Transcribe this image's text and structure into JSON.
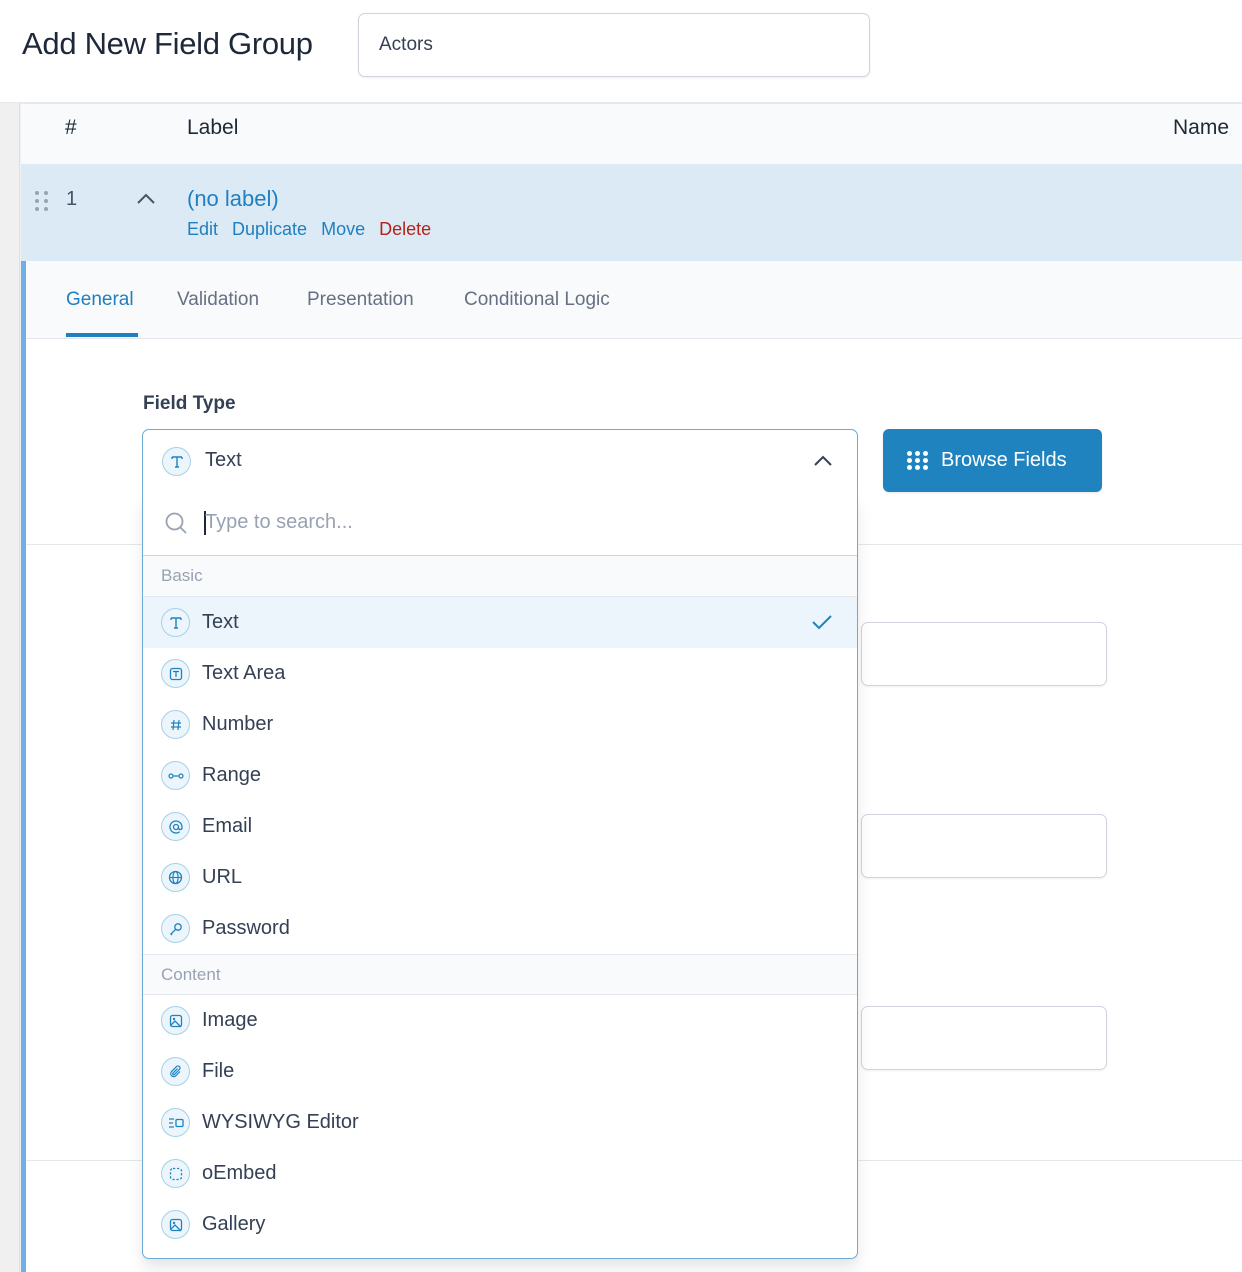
{
  "header": {
    "page_title": "Add New Field Group",
    "title_input_value": "Actors"
  },
  "table": {
    "columns": [
      "#",
      "Label",
      "Name"
    ]
  },
  "field": {
    "number": "1",
    "label": "(no label)",
    "actions": [
      "Edit",
      "Duplicate",
      "Move",
      "Delete"
    ]
  },
  "tabs": [
    {
      "label": "General",
      "active": true
    },
    {
      "label": "Validation",
      "active": false
    },
    {
      "label": "Presentation",
      "active": false
    },
    {
      "label": "Conditional Logic",
      "active": false
    }
  ],
  "field_type": {
    "label": "Field Type",
    "selected": "Text",
    "selected_icon": "text-icon",
    "browse_button": "Browse Fields",
    "search_placeholder": "Type to search...",
    "groups": [
      {
        "name": "Basic",
        "options": [
          {
            "label": "Text",
            "icon": "text-icon",
            "selected": true
          },
          {
            "label": "Text Area",
            "icon": "textarea-icon",
            "selected": false
          },
          {
            "label": "Number",
            "icon": "number-icon",
            "selected": false
          },
          {
            "label": "Range",
            "icon": "range-icon",
            "selected": false
          },
          {
            "label": "Email",
            "icon": "email-icon",
            "selected": false
          },
          {
            "label": "URL",
            "icon": "globe-icon",
            "selected": false
          },
          {
            "label": "Password",
            "icon": "key-icon",
            "selected": false
          }
        ]
      },
      {
        "name": "Content",
        "options": [
          {
            "label": "Image",
            "icon": "image-icon",
            "selected": false
          },
          {
            "label": "File",
            "icon": "paperclip-icon",
            "selected": false
          },
          {
            "label": "WYSIWYG Editor",
            "icon": "wysiwyg-icon",
            "selected": false
          },
          {
            "label": "oEmbed",
            "icon": "embed-icon",
            "selected": false
          },
          {
            "label": "Gallery",
            "icon": "gallery-icon",
            "selected": false
          }
        ]
      }
    ]
  },
  "colors": {
    "accent": "#1f83bf",
    "link": "#1f7fbf",
    "delete": "#b42318",
    "row_highlight": "#dbeaf5",
    "field_border": "#72aee6"
  }
}
